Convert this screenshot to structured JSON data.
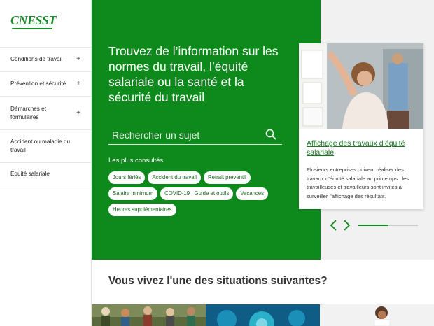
{
  "logo": {
    "text": "CNESST"
  },
  "sidebar": {
    "items": [
      {
        "label": "Conditions de travail",
        "expandable": "+"
      },
      {
        "label": "Prévention et sécurité",
        "expandable": "+"
      },
      {
        "label": "Démarches et formulaires",
        "expandable": "+"
      },
      {
        "label": "Accident ou maladie du travail",
        "expandable": ""
      },
      {
        "label": "Équité salariale",
        "expandable": ""
      }
    ]
  },
  "hero": {
    "title": "Trouvez de l’information sur les normes du travail, l’équité salariale ou la santé et la sécurité du travail",
    "search_placeholder": "Rechercher un sujet",
    "popular_label": "Les plus consultés",
    "chips": [
      "Jours fériés",
      "Accident du travail",
      "Retrait préventif",
      "Salaire minimum",
      "COVID-19 : Guide et outils",
      "Vacances",
      "Heures supplémentaires"
    ]
  },
  "news": {
    "link_title": "Affichage des travaux d’équité salariale",
    "description": "Plusieurs entreprises doivent réaliser des travaux d’équité salariale au printemps : les travailleuses et travailleurs sont invités à surveiller l’affichage des résultats.",
    "carousel_progress": 0.5
  },
  "situations": {
    "title": "Vous vivez l'une des situations suivantes?"
  },
  "colors": {
    "brand_green": "#0e8a1c",
    "link_green": "#1a7a24",
    "chip_text": "#1b5e20"
  },
  "icons": {
    "search": "search-icon",
    "prev": "chevron-left-icon",
    "next": "chevron-right-icon"
  }
}
